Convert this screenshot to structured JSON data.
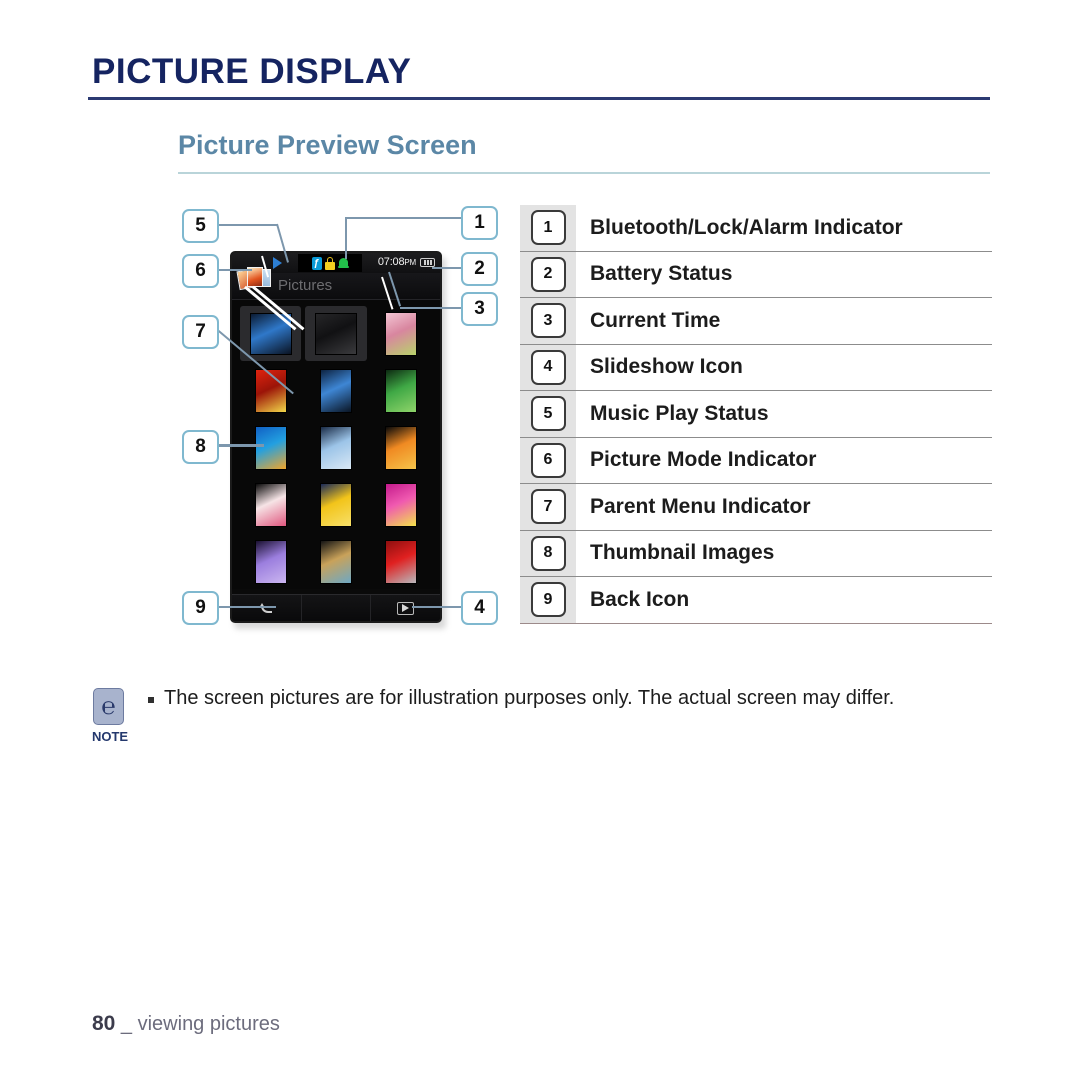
{
  "page": {
    "title": "PICTURE DISPLAY",
    "section_title": "Picture Preview Screen",
    "footer_page_number": "80",
    "footer_separator": "_",
    "footer_label": "viewing pictures"
  },
  "device": {
    "status_bar": {
      "music_play_status_icon": "play-icon",
      "bluetooth_icon": "bluetooth-icon",
      "lock_icon": "lock-icon",
      "alarm_icon": "alarm-bell-icon",
      "time": "07:08",
      "meridiem": "PM",
      "battery_icon": "battery-icon"
    },
    "title_bar": {
      "picture_mode_icon": "picture-mode-icon",
      "parent_menu_label": "Pictures"
    },
    "thumbnails": [
      {
        "name": "blue-agave-plant",
        "selected": true,
        "wide": true,
        "colors": [
          "#0b1b33",
          "#2f78c9",
          "#0a1322"
        ]
      },
      {
        "name": "dark-photo-frame",
        "selected": true,
        "wide": true,
        "colors": [
          "#262628",
          "#111113",
          "#3a3a3d"
        ]
      },
      {
        "name": "pink-berries",
        "selected": false,
        "wide": false,
        "colors": [
          "#f3c6d4",
          "#d8869f",
          "#b8d36a"
        ]
      },
      {
        "name": "red-strawberries",
        "selected": false,
        "wide": false,
        "colors": [
          "#e0230f",
          "#9c1408",
          "#f2d84a"
        ]
      },
      {
        "name": "blue-agave-plant-2",
        "selected": false,
        "wide": false,
        "colors": [
          "#0d2342",
          "#3e86d4",
          "#0a1524"
        ]
      },
      {
        "name": "green-leaf",
        "selected": false,
        "wide": false,
        "colors": [
          "#0d2a12",
          "#3fa845",
          "#8fd46a"
        ]
      },
      {
        "name": "starfish-blue-sea",
        "selected": false,
        "wide": false,
        "colors": [
          "#1060c4",
          "#23a0e0",
          "#f0a62a"
        ]
      },
      {
        "name": "blue-hydrangea",
        "selected": false,
        "wide": false,
        "colors": [
          "#1a2b46",
          "#9cc4e8",
          "#d9e8f5"
        ]
      },
      {
        "name": "orange-butterfly",
        "selected": false,
        "wide": false,
        "colors": [
          "#0a0a0a",
          "#f08a22",
          "#f5c44a"
        ]
      },
      {
        "name": "pink-white-petal",
        "selected": false,
        "wide": false,
        "colors": [
          "#0a0a0a",
          "#f6e4e6",
          "#e0577f"
        ]
      },
      {
        "name": "yellow-tulip",
        "selected": false,
        "wide": false,
        "colors": [
          "#1a2a58",
          "#f2c41a",
          "#f7e06a"
        ]
      },
      {
        "name": "magenta-dahlia",
        "selected": false,
        "wide": false,
        "colors": [
          "#c41a8c",
          "#f05ab0",
          "#f2e24a"
        ]
      },
      {
        "name": "purple-crocus",
        "selected": false,
        "wide": false,
        "colors": [
          "#1a1030",
          "#9b7ede",
          "#cbb6f0"
        ]
      },
      {
        "name": "striped-fibers",
        "selected": false,
        "wide": false,
        "colors": [
          "#141414",
          "#c9a25a",
          "#6ea8c4"
        ]
      },
      {
        "name": "red-car-grille",
        "selected": false,
        "wide": false,
        "colors": [
          "#8e0f0f",
          "#e02020",
          "#b8b8bc"
        ]
      }
    ],
    "bottom_bar": {
      "back_icon": "back-arrow-icon",
      "slideshow_icon": "slideshow-play-icon"
    }
  },
  "callouts": [
    {
      "number": "1",
      "target": "bluetooth-lock-alarm-indicator"
    },
    {
      "number": "2",
      "target": "battery-status"
    },
    {
      "number": "3",
      "target": "current-time"
    },
    {
      "number": "4",
      "target": "slideshow-icon"
    },
    {
      "number": "5",
      "target": "music-play-status"
    },
    {
      "number": "6",
      "target": "picture-mode-indicator"
    },
    {
      "number": "7",
      "target": "parent-menu-indicator"
    },
    {
      "number": "8",
      "target": "thumbnail-images"
    },
    {
      "number": "9",
      "target": "back-icon"
    }
  ],
  "legend": {
    "rows": [
      {
        "number": "1",
        "label": "Bluetooth/Lock/Alarm Indicator"
      },
      {
        "number": "2",
        "label": "Battery Status"
      },
      {
        "number": "3",
        "label": "Current Time"
      },
      {
        "number": "4",
        "label": "Slideshow Icon"
      },
      {
        "number": "5",
        "label": "Music Play Status"
      },
      {
        "number": "6",
        "label": "Picture Mode Indicator"
      },
      {
        "number": "7",
        "label": "Parent Menu Indicator"
      },
      {
        "number": "8",
        "label": "Thumbnail Images"
      },
      {
        "number": "9",
        "label": "Back Icon"
      }
    ]
  },
  "note": {
    "icon": "note-pen-icon",
    "caption": "NOTE",
    "text": "The screen pictures are for illustration purposes only. The actual screen may differ."
  },
  "colors": {
    "title_navy": "#152461",
    "section_steel_blue": "#5b87a6",
    "callout_border": "#7fb8cf",
    "leader_line": "#7d97ad",
    "legend_column_bg": "#e3e3e3",
    "note_icon_bg": "#a8b3cd",
    "footer_text": "#6c6c7d"
  }
}
